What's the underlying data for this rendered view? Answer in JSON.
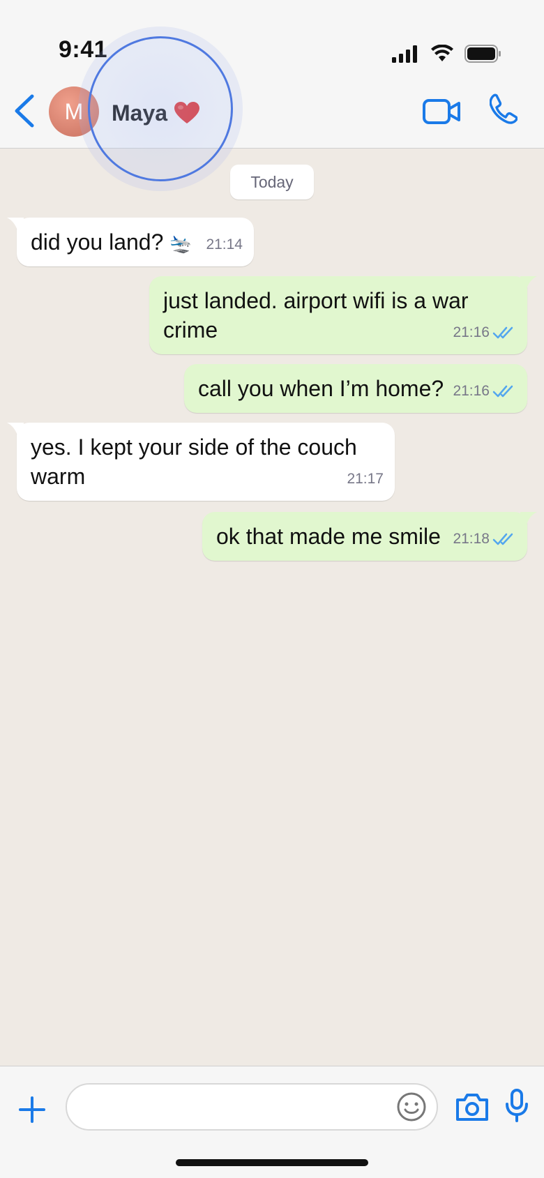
{
  "status_bar": {
    "time": "9:41"
  },
  "header": {
    "avatar_initial": "M",
    "contact_name": "Maya",
    "accent_color": "#1a7ae8"
  },
  "chat": {
    "date_label": "Today",
    "messages": [
      {
        "direction": "incoming",
        "text": "did you land?",
        "emoji": "🛬",
        "time": "21:14"
      },
      {
        "direction": "outgoing",
        "text": "just landed. airport wifi is a war crime",
        "time": "21:16",
        "status": "read"
      },
      {
        "direction": "outgoing",
        "text": "call you when I’m home?",
        "time": "21:16",
        "status": "read"
      },
      {
        "direction": "incoming",
        "text": "yes. I kept your side of the couch warm",
        "time": "21:17"
      },
      {
        "direction": "outgoing",
        "text": "ok that made me smile",
        "time": "21:18",
        "status": "read"
      }
    ]
  },
  "input": {
    "placeholder": ""
  },
  "colors": {
    "incoming": "#ffffff",
    "outgoing": "#e1f7cf",
    "background": "#efeae4",
    "read_ticks": "#53a6ee"
  }
}
